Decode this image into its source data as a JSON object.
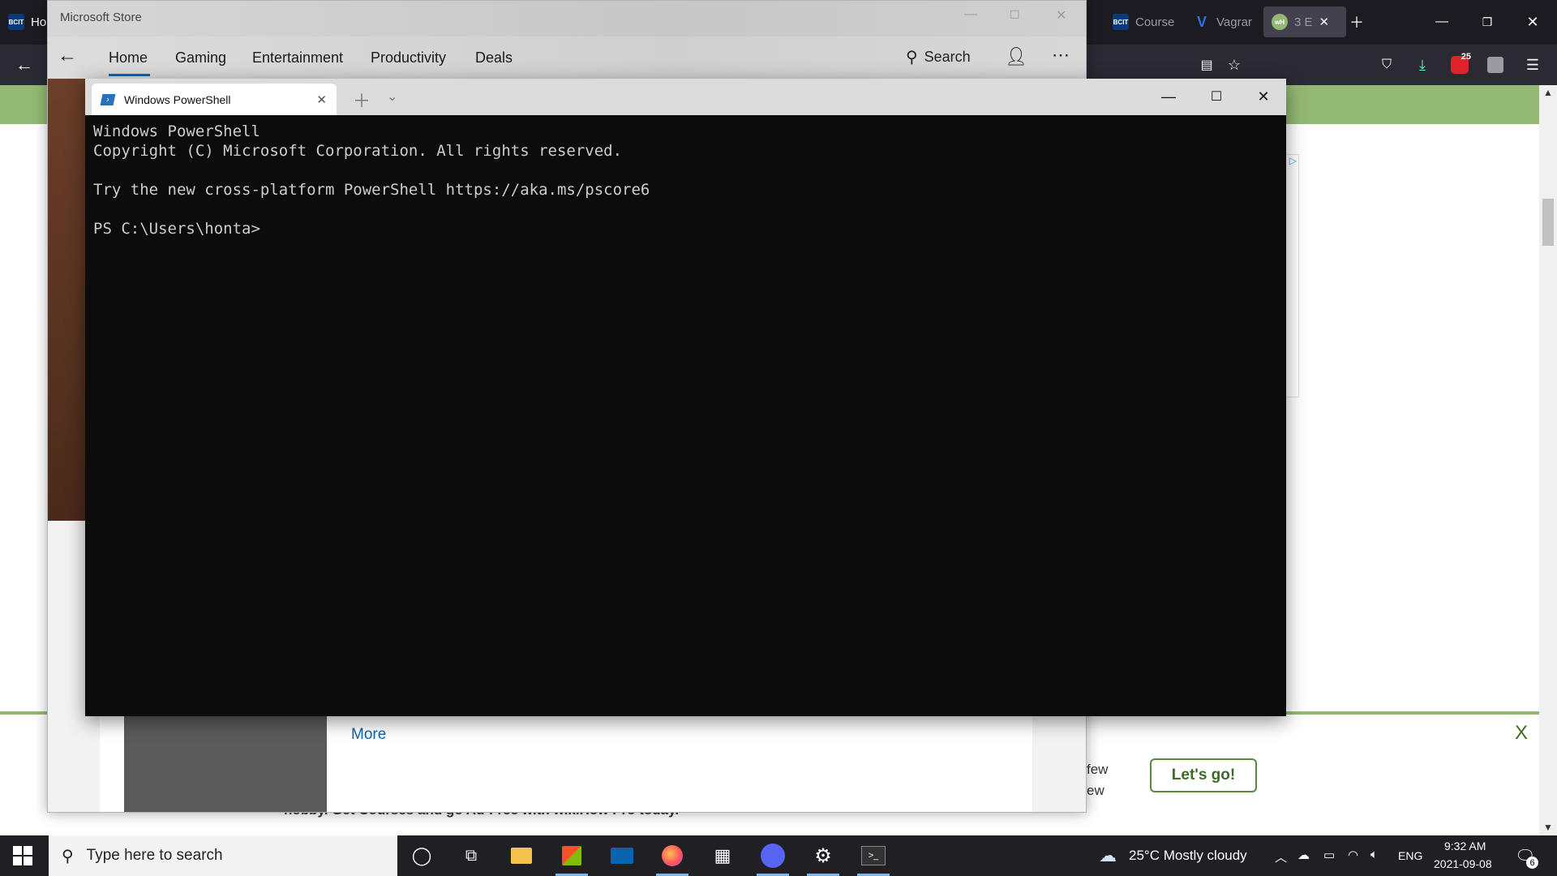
{
  "browser": {
    "tabs": [
      {
        "label": "Ho",
        "favicon": "BCIT"
      },
      {
        "label": "Course",
        "favicon": "BCIT"
      },
      {
        "label": "Vagrar",
        "favicon": "V"
      },
      {
        "label": "3 E",
        "favicon": "wikiHow"
      }
    ],
    "addon_badge": "25",
    "close_ad_label": "X",
    "ad_text_1": "few",
    "ad_text_2": "ew",
    "cta_label": "Let's go!",
    "promo_text": "hobby. Get Courses and go Ad-Free with wikiHow Pro today."
  },
  "store": {
    "title": "Microsoft Store",
    "nav": [
      "Home",
      "Gaming",
      "Entertainment",
      "Productivity",
      "Deals"
    ],
    "search_label": "Search",
    "more_link": "More"
  },
  "powershell": {
    "tab_title": "Windows PowerShell",
    "console": "Windows PowerShell\nCopyright (C) Microsoft Corporation. All rights reserved.\n\nTry the new cross-platform PowerShell https://aka.ms/pscore6\n\nPS C:\\Users\\honta>"
  },
  "taskbar": {
    "search_placeholder": "Type here to search",
    "weather": "25°C  Mostly cloudy",
    "language": "ENG",
    "time": "9:32 AM",
    "date": "2021-09-08",
    "notification_count": "6"
  },
  "colors": {
    "accent_green": "#93b874",
    "store_underline": "#0067b8",
    "taskbar_highlight": "#76b9ed"
  }
}
